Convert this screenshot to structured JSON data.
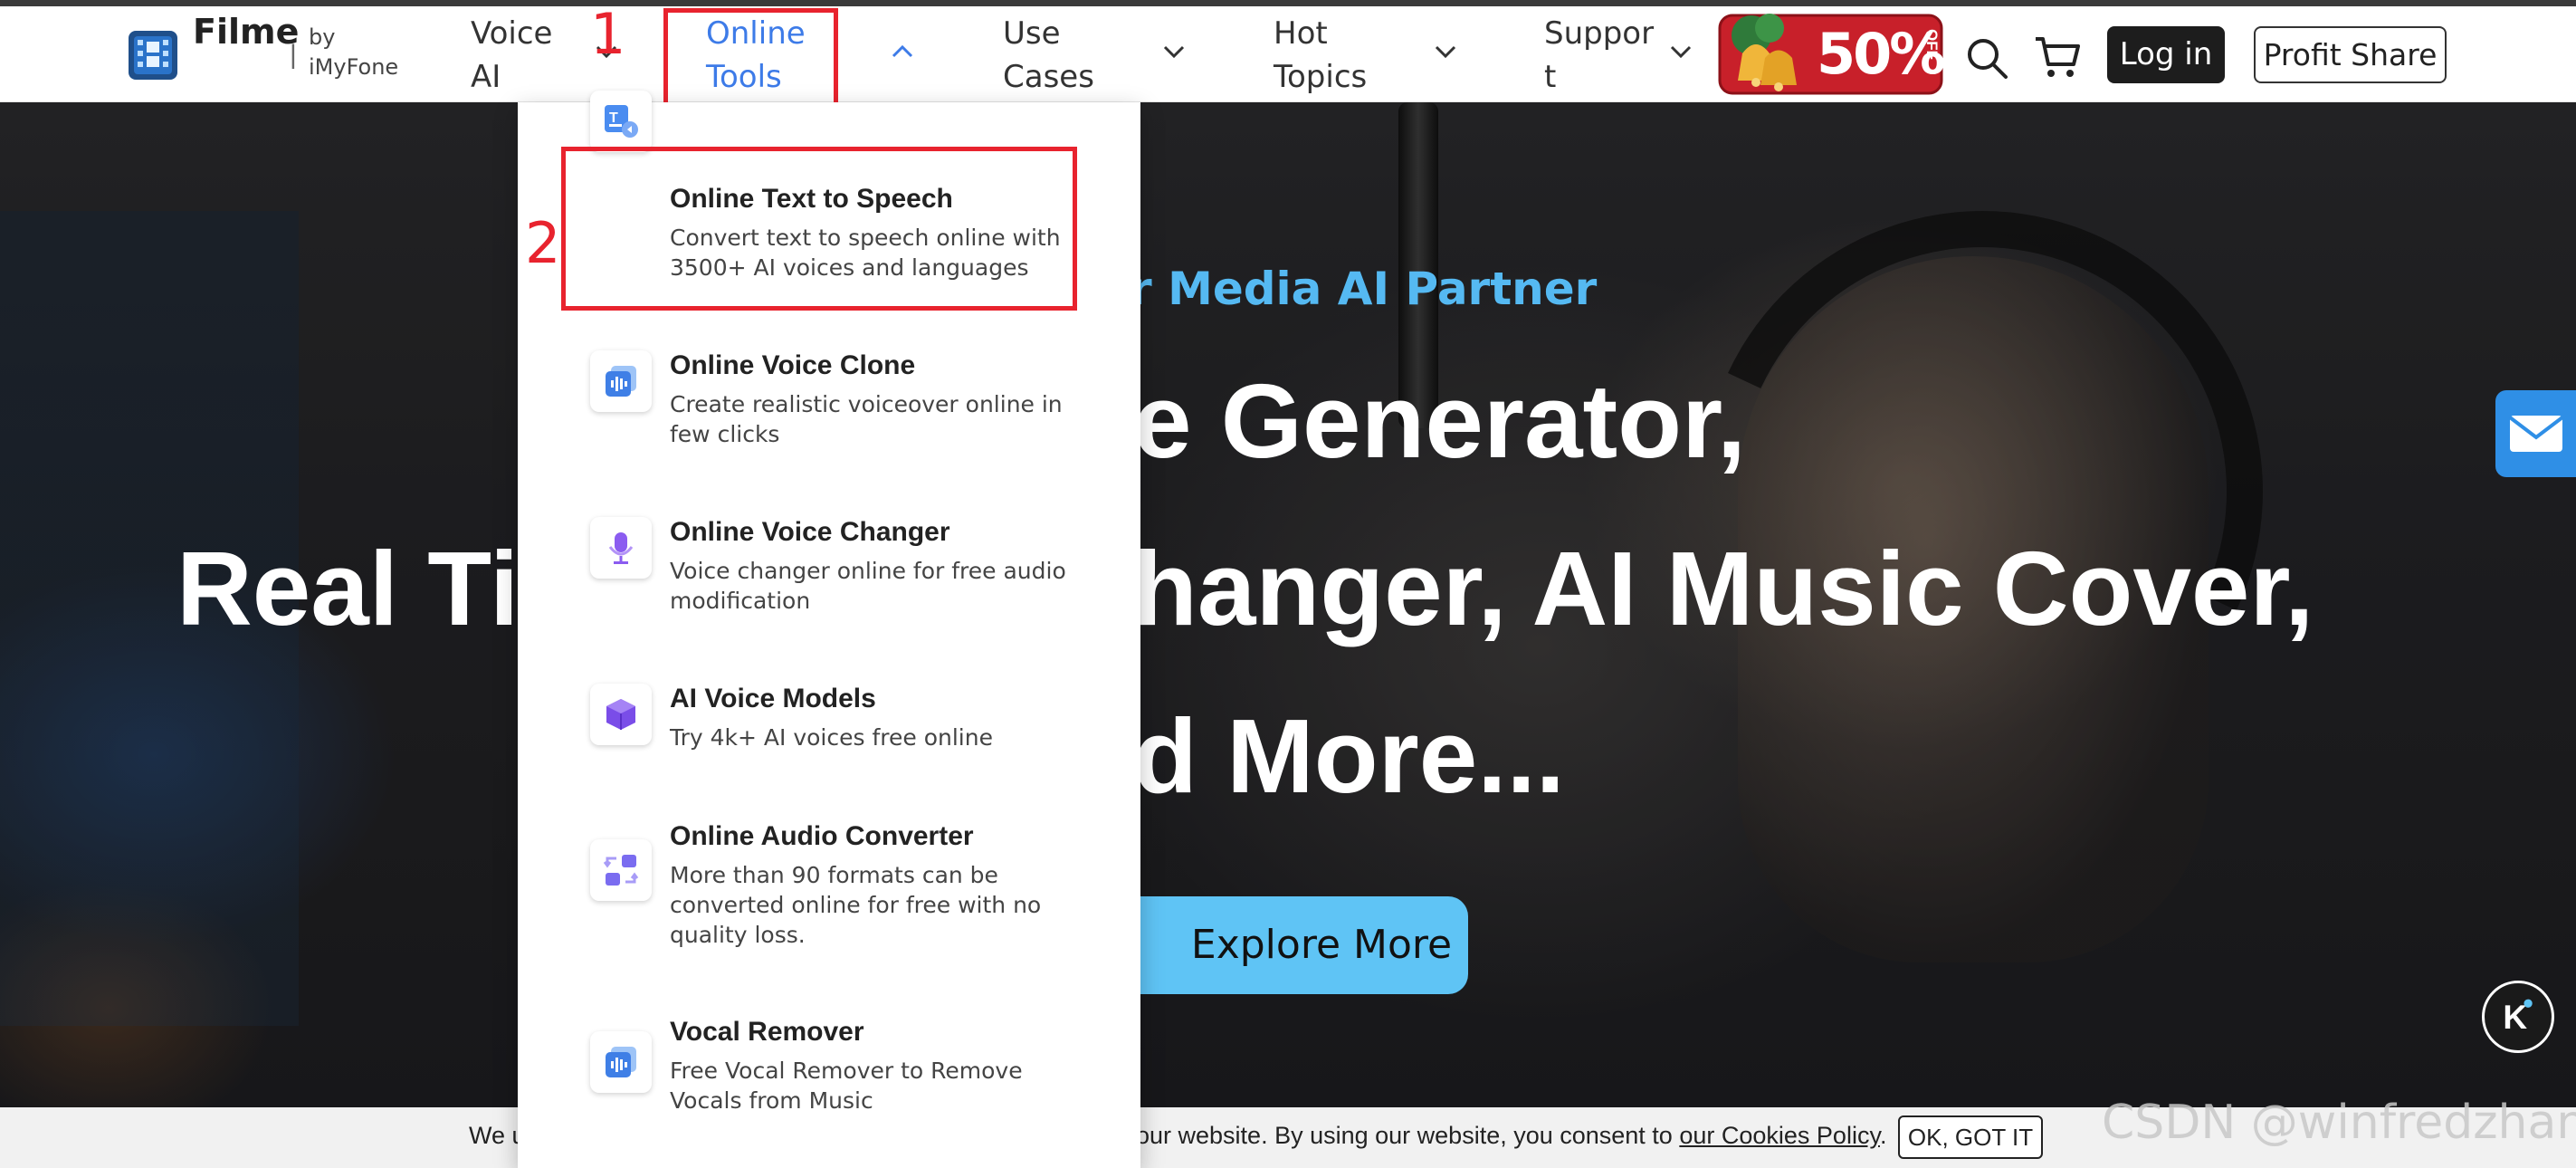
{
  "brand": {
    "name": "Filme",
    "separator": "|",
    "by": "by iMyFone"
  },
  "nav": {
    "items": [
      {
        "label": "Voice AI"
      },
      {
        "label": "Online Tools"
      },
      {
        "label": "Use Cases"
      },
      {
        "label": "Hot Topics"
      },
      {
        "label": "Support"
      }
    ]
  },
  "promo": {
    "text": "50%",
    "subtext": "OFF"
  },
  "actions": {
    "login_label": "Log in",
    "profit_label": "Profit Share"
  },
  "annotations": {
    "step1": "1",
    "step2": "2"
  },
  "dropdown": {
    "items": [
      {
        "title": "Online Text to Speech",
        "desc": "Convert text to speech online with 3500+ AI voices and languages",
        "icon": "text-to-speech-icon"
      },
      {
        "title": "Online Voice Clone",
        "desc": "Create realistic voiceover online in few clicks",
        "icon": "voice-clone-icon"
      },
      {
        "title": "Online Voice Changer",
        "desc": "Voice changer online for free audio modification",
        "icon": "voice-changer-icon"
      },
      {
        "title": "AI Voice Models",
        "desc": "Try 4k+ AI voices free online",
        "icon": "cube-icon"
      },
      {
        "title": "Online Audio Converter",
        "desc": "More than 90 formats can be converted online for free with no quality loss.",
        "icon": "audio-converter-icon"
      },
      {
        "title": "Vocal Remover",
        "desc": "Free Vocal Remover to Remove Vocals from Music",
        "icon": "vocal-remover-icon"
      }
    ]
  },
  "hero": {
    "subtitle": "r Media AI Partner",
    "line1": "e Generator,",
    "line2_left": "Real Ti",
    "line2_right": "hanger, AI Music Cover,",
    "line3": "d More...",
    "cta": "Explore More"
  },
  "cookie": {
    "text_left": "We u",
    "text_right": "our website. By using our website, you consent to",
    "link": "our Cookies Policy",
    "period": ".",
    "ok": "OK, GOT IT"
  },
  "watermark": "CSDN @winfredzhang",
  "colors": {
    "accent": "#3d7be8",
    "annotation": "#e8232e",
    "hero_sub": "#55b9f2",
    "cta": "#5fc4f5"
  }
}
